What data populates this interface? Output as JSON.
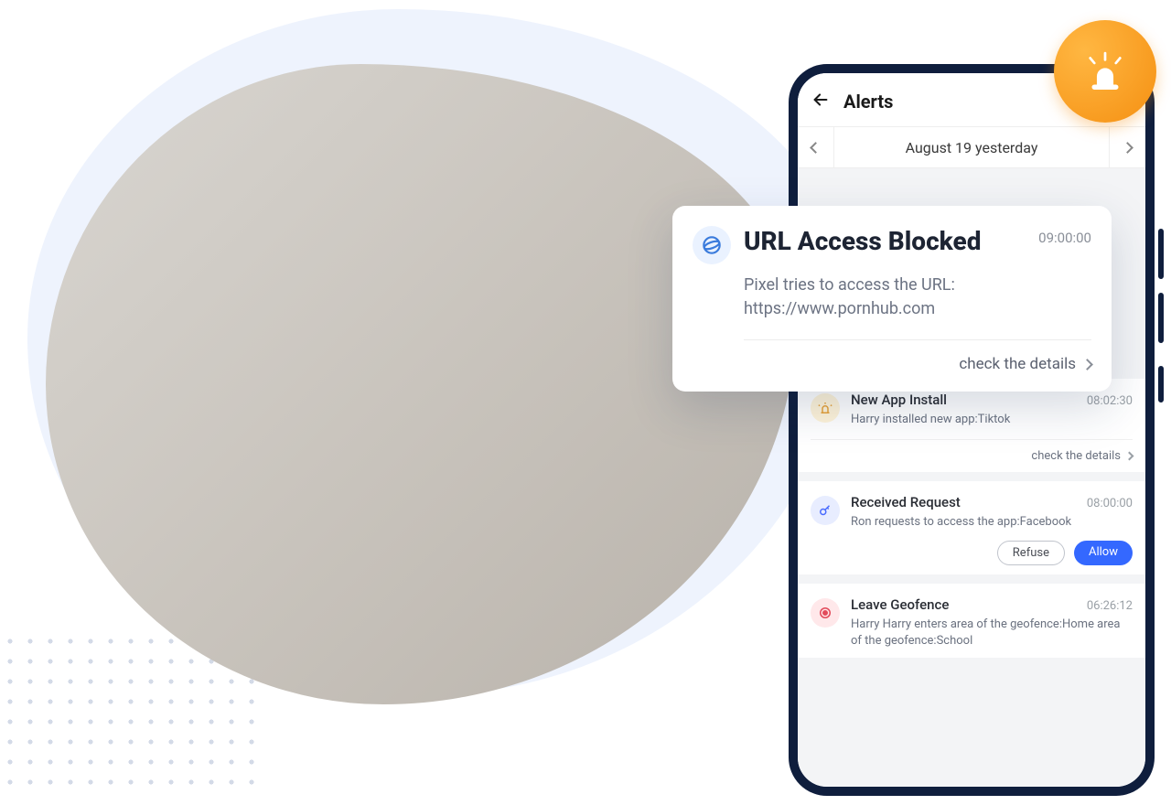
{
  "header": {
    "title": "Alerts"
  },
  "date": {
    "label": "August 19 yesterday"
  },
  "popout": {
    "title": "URL Access Blocked",
    "time": "09:00:00",
    "desc": "Pixel tries to access the URL: https://www.pornhub.com",
    "details": "check the details"
  },
  "alerts": [
    {
      "title": "New App Install",
      "time": "08:02:30",
      "desc": "Harry installed new app:Tiktok",
      "details": "check the details"
    },
    {
      "title": "Received Request",
      "time": "08:00:00",
      "desc": "Ron requests to access the app:Facebook",
      "refuse": "Refuse",
      "allow": "Allow"
    },
    {
      "title": "Leave Geofence",
      "time": "06:26:12",
      "desc": "Harry Harry enters area of the geofence:Home area of the geofence:School"
    }
  ]
}
